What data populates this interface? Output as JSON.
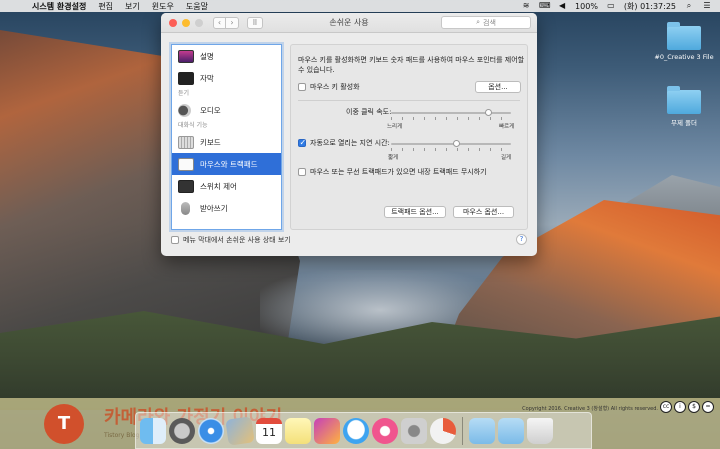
{
  "menubar": {
    "apple_icon": "apple-icon",
    "app_name": "시스템 환경설정",
    "menus": [
      "편집",
      "보기",
      "윈도우",
      "도움말"
    ],
    "battery_percent": "100%",
    "clock": "(화) 01:37:25"
  },
  "desktop": {
    "folders": [
      {
        "label": "#0_Creative 3 File"
      },
      {
        "label": "무제 폴더"
      }
    ]
  },
  "window": {
    "title": "손쉬운 사용",
    "search_placeholder": "검색",
    "sidebar": {
      "items": [
        {
          "label": "설명",
          "icon": "display-icon"
        },
        {
          "label": "자막",
          "icon": "caption-icon"
        },
        {
          "header": "듣기"
        },
        {
          "label": "오디오",
          "icon": "speaker-icon"
        },
        {
          "header": "대화식 기능"
        },
        {
          "label": "키보드",
          "icon": "keyboard-icon"
        },
        {
          "label": "마우스와 트랙패드",
          "icon": "mouse-icon",
          "selected": true
        },
        {
          "label": "스위치 제어",
          "icon": "switch-icon"
        },
        {
          "label": "받아쓰기",
          "icon": "microphone-icon"
        }
      ]
    },
    "pane": {
      "description_line1": "마우스 키를 활성화하면 키보드 숫자 패드를 사용하여 마우스 포인터를 제어할",
      "description_line2": "수 있습니다.",
      "mouse_keys_label": "마우스 키 활성화",
      "mouse_keys_checked": false,
      "options_button": "옵션...",
      "double_click_label": "이중 클릭 속도:",
      "double_click_min": "느리게",
      "double_click_max": "빠르게",
      "double_click_value": 0.82,
      "spring_load_label": "자동으로 열리는 지연 시간:",
      "spring_load_checked": true,
      "spring_load_min": "짧게",
      "spring_load_max": "길게",
      "spring_load_value": 0.55,
      "ignore_trackpad_label": "마우스 또는 무선 트랙패드가 있으면 내장 트랙패드 무시하기",
      "ignore_trackpad_checked": false,
      "trackpad_options_button": "트랙패드 옵션...",
      "mouse_options_button": "마우스 옵션..."
    },
    "footer_label": "메뉴 막대에서 손쉬운 사용 상태 보기",
    "footer_checked": false,
    "help": "?"
  },
  "banner": {
    "logo": "T",
    "title": "카메라와 가정기 이야기",
    "subtitle": "Tistory Blog",
    "copyright": "Copyright 2016. Creative 3 (창설형) All rights reserved."
  },
  "dock": {
    "icons": [
      "finder-icon",
      "launchpad-icon",
      "safari-icon",
      "photo-icon",
      "calendar-icon",
      "notes-icon",
      "photos-icon",
      "messages-icon",
      "itunes-icon",
      "system-preferences-icon",
      "activity-icon",
      "folder-icon",
      "folder-icon",
      "trash-icon"
    ],
    "calendar_day": "11"
  }
}
